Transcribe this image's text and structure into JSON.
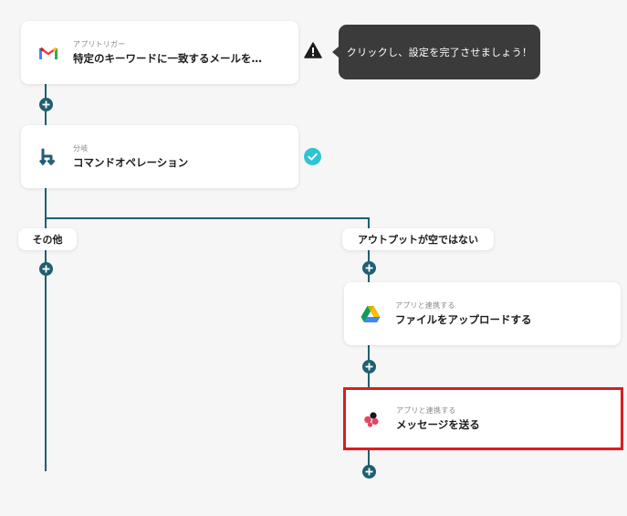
{
  "flow": {
    "step_trigger": {
      "sub_label": "アプリトリガー",
      "title": "特定のキーワードに一致するメールを…",
      "icon": "gmail-icon"
    },
    "warning_tooltip": "クリックし、設定を完了させましょう！",
    "step_branch": {
      "sub_label": "分岐",
      "title": "コマンドオペレーション",
      "icon": "branch-icon",
      "status": "completed"
    },
    "branch_left": {
      "label": "その他"
    },
    "branch_right": {
      "label": "アウトプットが空ではない",
      "steps": [
        {
          "sub_label": "アプリと連携する",
          "title": "ファイルをアップロードする",
          "icon": "google-drive-icon"
        },
        {
          "sub_label": "アプリと連携する",
          "title": "メッセージを送る",
          "icon": "asana-icon",
          "highlighted": true
        }
      ]
    }
  },
  "colors": {
    "connector": "#1f5f72",
    "check_badge": "#2dc5d6",
    "highlight": "#d81e22",
    "tooltip_bg": "#3b3b3b",
    "background": "#f6f6f6"
  }
}
